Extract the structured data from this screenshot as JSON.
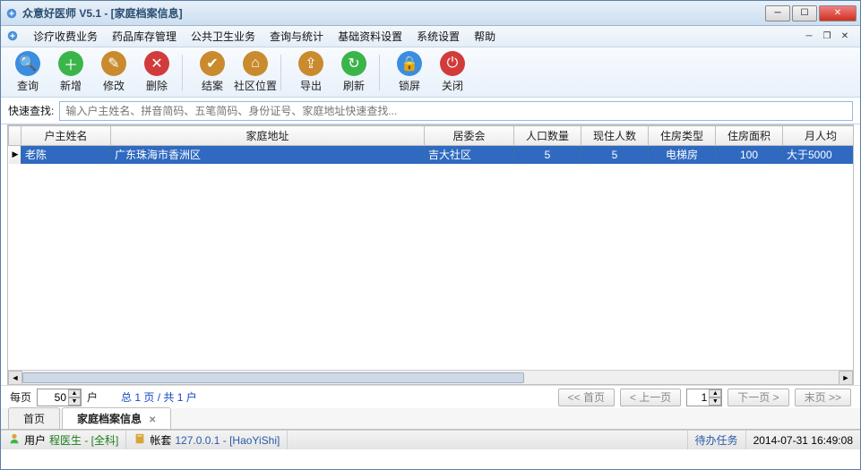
{
  "window": {
    "title": "众意好医师 V5.1 - [家庭档案信息]"
  },
  "menu": {
    "items": [
      "诊疗收费业务",
      "药品库存管理",
      "公共卫生业务",
      "查询与统计",
      "基础资料设置",
      "系统设置",
      "帮助"
    ]
  },
  "toolbar": {
    "buttons": [
      {
        "label": "查询",
        "icon": "search-icon",
        "bg": "#3a8de0"
      },
      {
        "label": "新增",
        "icon": "add-icon",
        "bg": "#3bb54a"
      },
      {
        "label": "修改",
        "icon": "edit-icon",
        "bg": "#c98b2e"
      },
      {
        "label": "删除",
        "icon": "delete-icon",
        "bg": "#d23b3b"
      },
      {
        "label": "结案",
        "icon": "close-case-icon",
        "bg": "#c98b2e",
        "sep_before": true
      },
      {
        "label": "社区位置",
        "icon": "location-icon",
        "bg": "#c98b2e"
      },
      {
        "label": "导出",
        "icon": "export-icon",
        "bg": "#c98b2e",
        "sep_before": true
      },
      {
        "label": "刷新",
        "icon": "refresh-icon",
        "bg": "#3bb54a"
      },
      {
        "label": "锁屏",
        "icon": "lock-icon",
        "bg": "#3a8de0",
        "sep_before": true
      },
      {
        "label": "关闭",
        "icon": "close-icon",
        "bg": "#d23b3b"
      }
    ]
  },
  "search": {
    "label": "快速查找:",
    "placeholder": "输入户主姓名、拼音简码、五笔简码、身份证号、家庭地址快速查找..."
  },
  "table": {
    "columns": [
      "户主姓名",
      "家庭地址",
      "居委会",
      "人口数量",
      "现住人数",
      "住房类型",
      "住房面积",
      "月人均"
    ],
    "widths": [
      100,
      350,
      100,
      75,
      75,
      75,
      75,
      85
    ],
    "rows": [
      {
        "cells": [
          "老陈",
          "广东珠海市香洲区",
          "吉大社区",
          "5",
          "5",
          "电梯房",
          "100",
          "大于5000"
        ]
      }
    ]
  },
  "pager": {
    "per_page_label": "每页",
    "per_page_value": "50",
    "unit": "户",
    "summary": "总 1 页 / 共 1 户",
    "first": "<< 首页",
    "prev": "< 上一页",
    "page": "1",
    "next": "下一页 >",
    "last": "末页 >>"
  },
  "tabs": {
    "items": [
      {
        "label": "首页",
        "closable": false,
        "active": false
      },
      {
        "label": "家庭档案信息",
        "closable": true,
        "active": true
      }
    ]
  },
  "status": {
    "user_label": "用户",
    "user_value": "程医生 - [全科]",
    "acct_label": "帐套",
    "acct_value": "127.0.0.1 - [HaoYiShi]",
    "task": "待办任务",
    "datetime": "2014-07-31 16:49:08"
  }
}
